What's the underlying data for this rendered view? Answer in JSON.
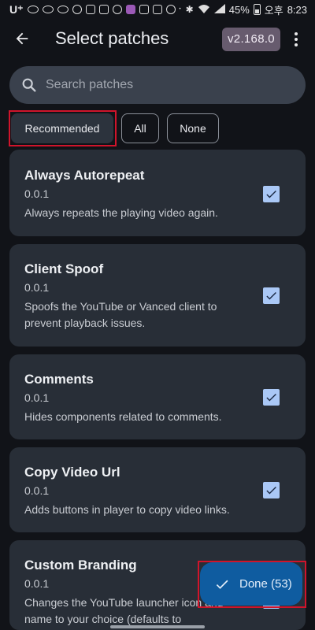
{
  "status_bar": {
    "carrier": "U⁺",
    "left_badges": [
      "D",
      "DIGI LOCA",
      "DIGI LOCA"
    ],
    "battery": "45%",
    "ampm": "오후",
    "time": "8:23"
  },
  "app_bar": {
    "title": "Select patches",
    "version": "v2.168.0",
    "back_icon": "arrow-back-icon",
    "menu_icon": "more-vert-icon"
  },
  "search": {
    "placeholder": "Search patches",
    "icon": "search-icon"
  },
  "filters": [
    {
      "label": "Recommended",
      "selected": true
    },
    {
      "label": "All",
      "selected": false
    },
    {
      "label": "None",
      "selected": false
    }
  ],
  "patches": [
    {
      "name": "Always Autorepeat",
      "version": "0.0.1",
      "description": "Always repeats the playing video again.",
      "checked": true
    },
    {
      "name": "Client Spoof",
      "version": "0.0.1",
      "description": "Spoofs the YouTube or Vanced client to prevent playback issues.",
      "checked": true
    },
    {
      "name": "Comments",
      "version": "0.0.1",
      "description": "Hides components related to comments.",
      "checked": true
    },
    {
      "name": "Copy Video Url",
      "version": "0.0.1",
      "description": "Adds buttons in player to copy video links.",
      "checked": true
    },
    {
      "name": "Custom Branding",
      "version": "0.0.1",
      "description": "Changes the YouTube launcher icon and name to your choice (defaults to",
      "checked": true
    }
  ],
  "done_button": {
    "label": "Done (53)",
    "icon": "check-icon"
  },
  "colors": {
    "background": "#111318",
    "card": "#282e37",
    "checkbox": "#aac8f6",
    "fab": "#0f5ca0",
    "version_chip": "#675b6e",
    "highlight": "#d0142b"
  }
}
